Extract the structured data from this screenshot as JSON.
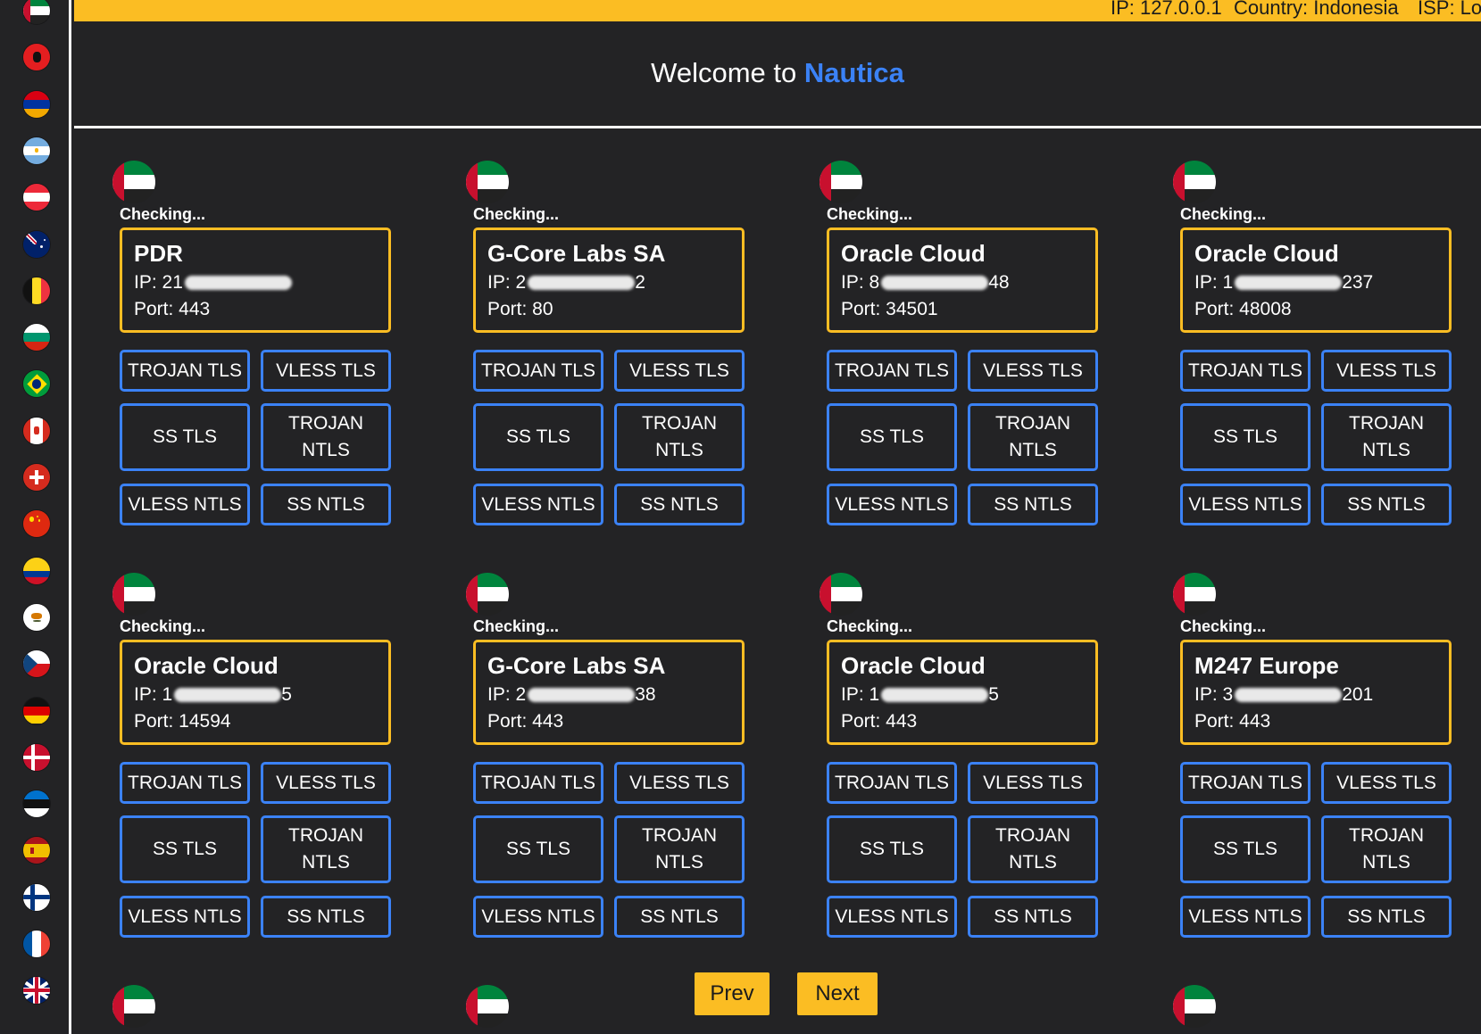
{
  "topbar": {
    "ip": "IP: 127.0.0.1",
    "country": "Country: Indonesia",
    "isp": "ISP: Lo"
  },
  "header": {
    "welcome_prefix": "Welcome to",
    "brand": "Nautica"
  },
  "sidebar": {
    "flags": [
      "ae",
      "al",
      "am",
      "ar",
      "at",
      "au",
      "be",
      "bg",
      "br",
      "ca",
      "ch",
      "cn",
      "co",
      "cy",
      "cz",
      "de",
      "dk",
      "ee",
      "es",
      "fi",
      "fr",
      "gb"
    ]
  },
  "buttons": {
    "trojan_tls": "TROJAN TLS",
    "vless_tls": "VLESS TLS",
    "ss_tls": "SS TLS",
    "trojan_ntls": "TROJAN NTLS",
    "vless_ntls": "VLESS NTLS",
    "ss_ntls": "SS NTLS"
  },
  "servers": [
    {
      "flag": "ae",
      "status": "Checking...",
      "provider": "PDR",
      "ip": "IP: 21",
      "ip_tail": "",
      "port": "Port: 443"
    },
    {
      "flag": "ae",
      "status": "Checking...",
      "provider": "G-Core Labs SA",
      "ip": "IP: 2",
      "ip_tail": "2",
      "port": "Port: 80"
    },
    {
      "flag": "ae",
      "status": "Checking...",
      "provider": "Oracle Cloud",
      "ip": "IP: 8",
      "ip_tail": "48",
      "port": "Port: 34501"
    },
    {
      "flag": "ae",
      "status": "Checking...",
      "provider": "Oracle Cloud",
      "ip": "IP: 1",
      "ip_tail": "237",
      "port": "Port: 48008"
    },
    {
      "flag": "ae",
      "status": "Checking...",
      "provider": "Oracle Cloud",
      "ip": "IP: 1",
      "ip_tail": "5",
      "port": "Port: 14594"
    },
    {
      "flag": "ae",
      "status": "Checking...",
      "provider": "G-Core Labs SA",
      "ip": "IP: 2",
      "ip_tail": "38",
      "port": "Port: 443"
    },
    {
      "flag": "ae",
      "status": "Checking...",
      "provider": "Oracle Cloud",
      "ip": "IP: 1",
      "ip_tail": "5",
      "port": "Port: 443"
    },
    {
      "flag": "ae",
      "status": "Checking...",
      "provider": "M247 Europe",
      "ip": "IP: 3",
      "ip_tail": "201",
      "port": "Port: 443"
    }
  ],
  "pagination": {
    "prev": "Prev",
    "next": "Next"
  },
  "colors": {
    "accent_yellow": "#fbbd23",
    "accent_blue": "#3b82f6",
    "background": "#232325"
  }
}
